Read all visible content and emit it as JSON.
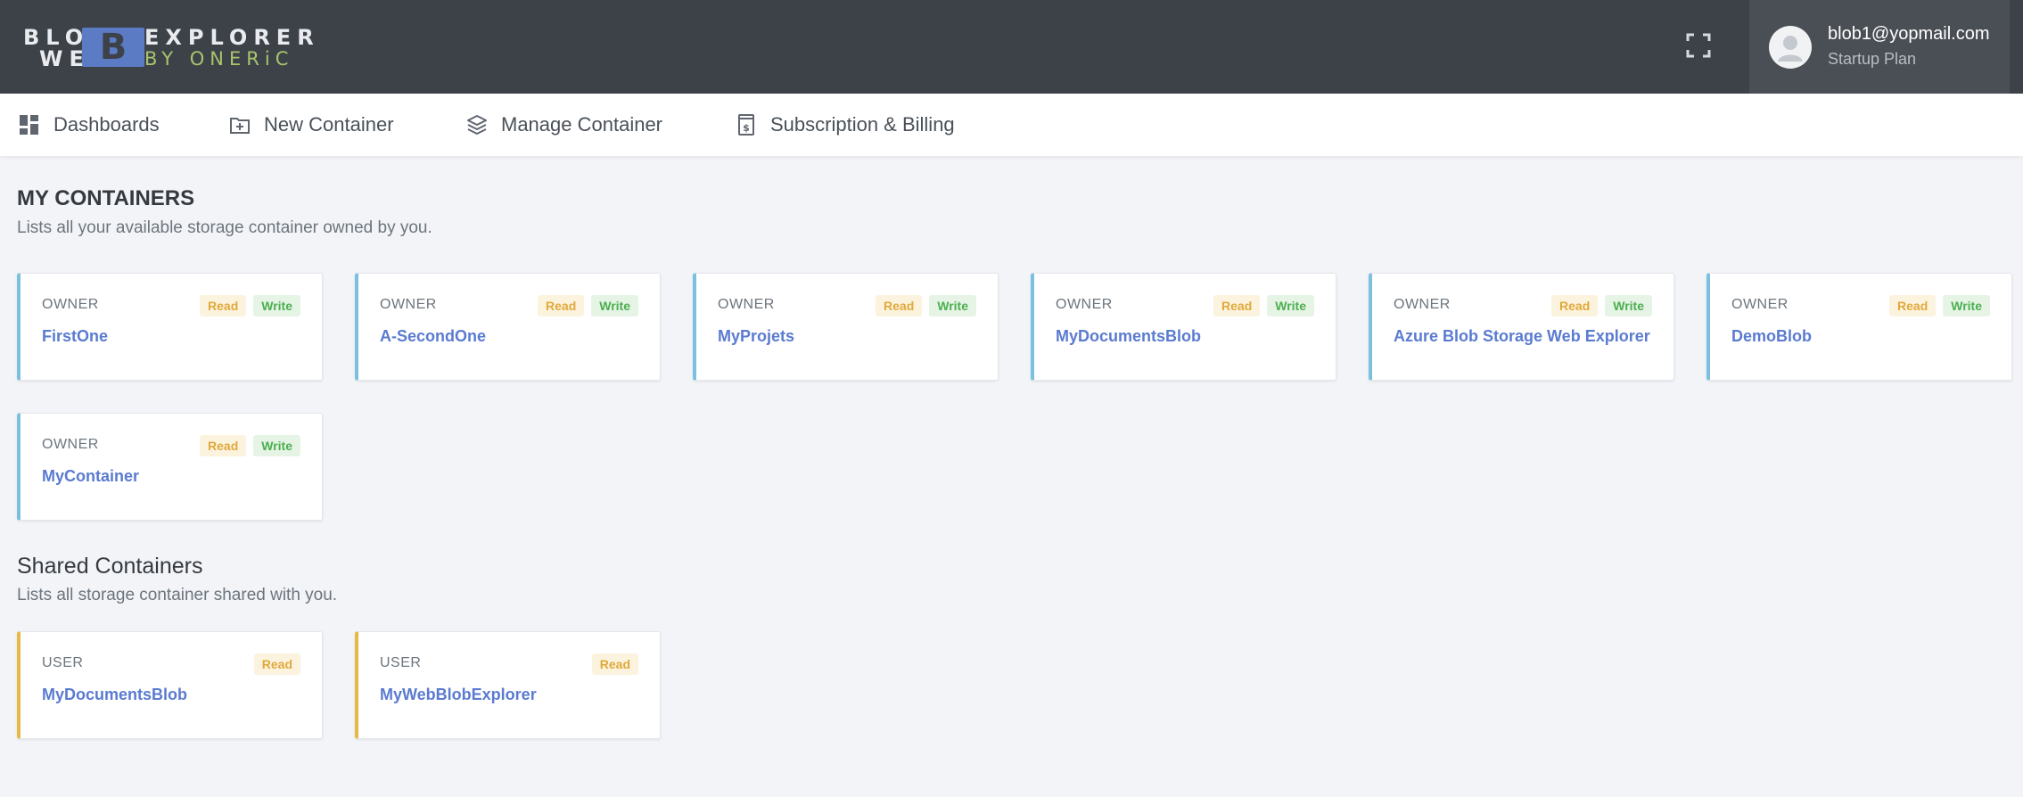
{
  "brand": {
    "logo_row1_left": "BLO",
    "logo_row1_right": "EXPLORER",
    "logo_row2_left": "WE",
    "logo_row2_right": "BY ONERiC",
    "logo_block_letter": "B",
    "accent_color": "#5b7cc4",
    "tagline_color": "#a9c46c"
  },
  "header": {
    "fullscreen_icon": "fullscreen-icon",
    "user": {
      "email": "blob1@yopmail.com",
      "plan": "Startup Plan"
    }
  },
  "nav": {
    "items": [
      {
        "label": "Dashboards",
        "icon": "dashboard-icon"
      },
      {
        "label": "New Container",
        "icon": "plus-square-icon"
      },
      {
        "label": "Manage Container",
        "icon": "layers-icon"
      },
      {
        "label": "Subscription & Billing",
        "icon": "receipt-dollar-icon"
      }
    ]
  },
  "my_containers": {
    "title": "MY CONTAINERS",
    "subtitle": "Lists all your available storage container owned by you.",
    "cards": [
      {
        "role": "OWNER",
        "name": "FirstOne",
        "badges": [
          "Read",
          "Write"
        ]
      },
      {
        "role": "OWNER",
        "name": "A-SecondOne",
        "badges": [
          "Read",
          "Write"
        ]
      },
      {
        "role": "OWNER",
        "name": "MyProjets",
        "badges": [
          "Read",
          "Write"
        ]
      },
      {
        "role": "OWNER",
        "name": "MyDocumentsBlob",
        "badges": [
          "Read",
          "Write"
        ]
      },
      {
        "role": "OWNER",
        "name": "Azure Blob Storage Web Explorer",
        "badges": [
          "Read",
          "Write"
        ]
      },
      {
        "role": "OWNER",
        "name": "DemoBlob",
        "badges": [
          "Read",
          "Write"
        ]
      },
      {
        "role": "OWNER",
        "name": "MyContainer",
        "badges": [
          "Read",
          "Write"
        ]
      }
    ]
  },
  "shared_containers": {
    "title": "Shared Containers",
    "subtitle": "Lists all storage container shared with you.",
    "cards": [
      {
        "role": "USER",
        "name": "MyDocumentsBlob",
        "badges": [
          "Read"
        ]
      },
      {
        "role": "USER",
        "name": "MyWebBlobExplorer",
        "badges": [
          "Read"
        ]
      }
    ]
  },
  "colors": {
    "owner_border": "#7cc0e0",
    "shared_border": "#e6b945",
    "read_badge": "#e0a93a",
    "write_badge": "#4caf50",
    "link": "#5a7bd0"
  }
}
